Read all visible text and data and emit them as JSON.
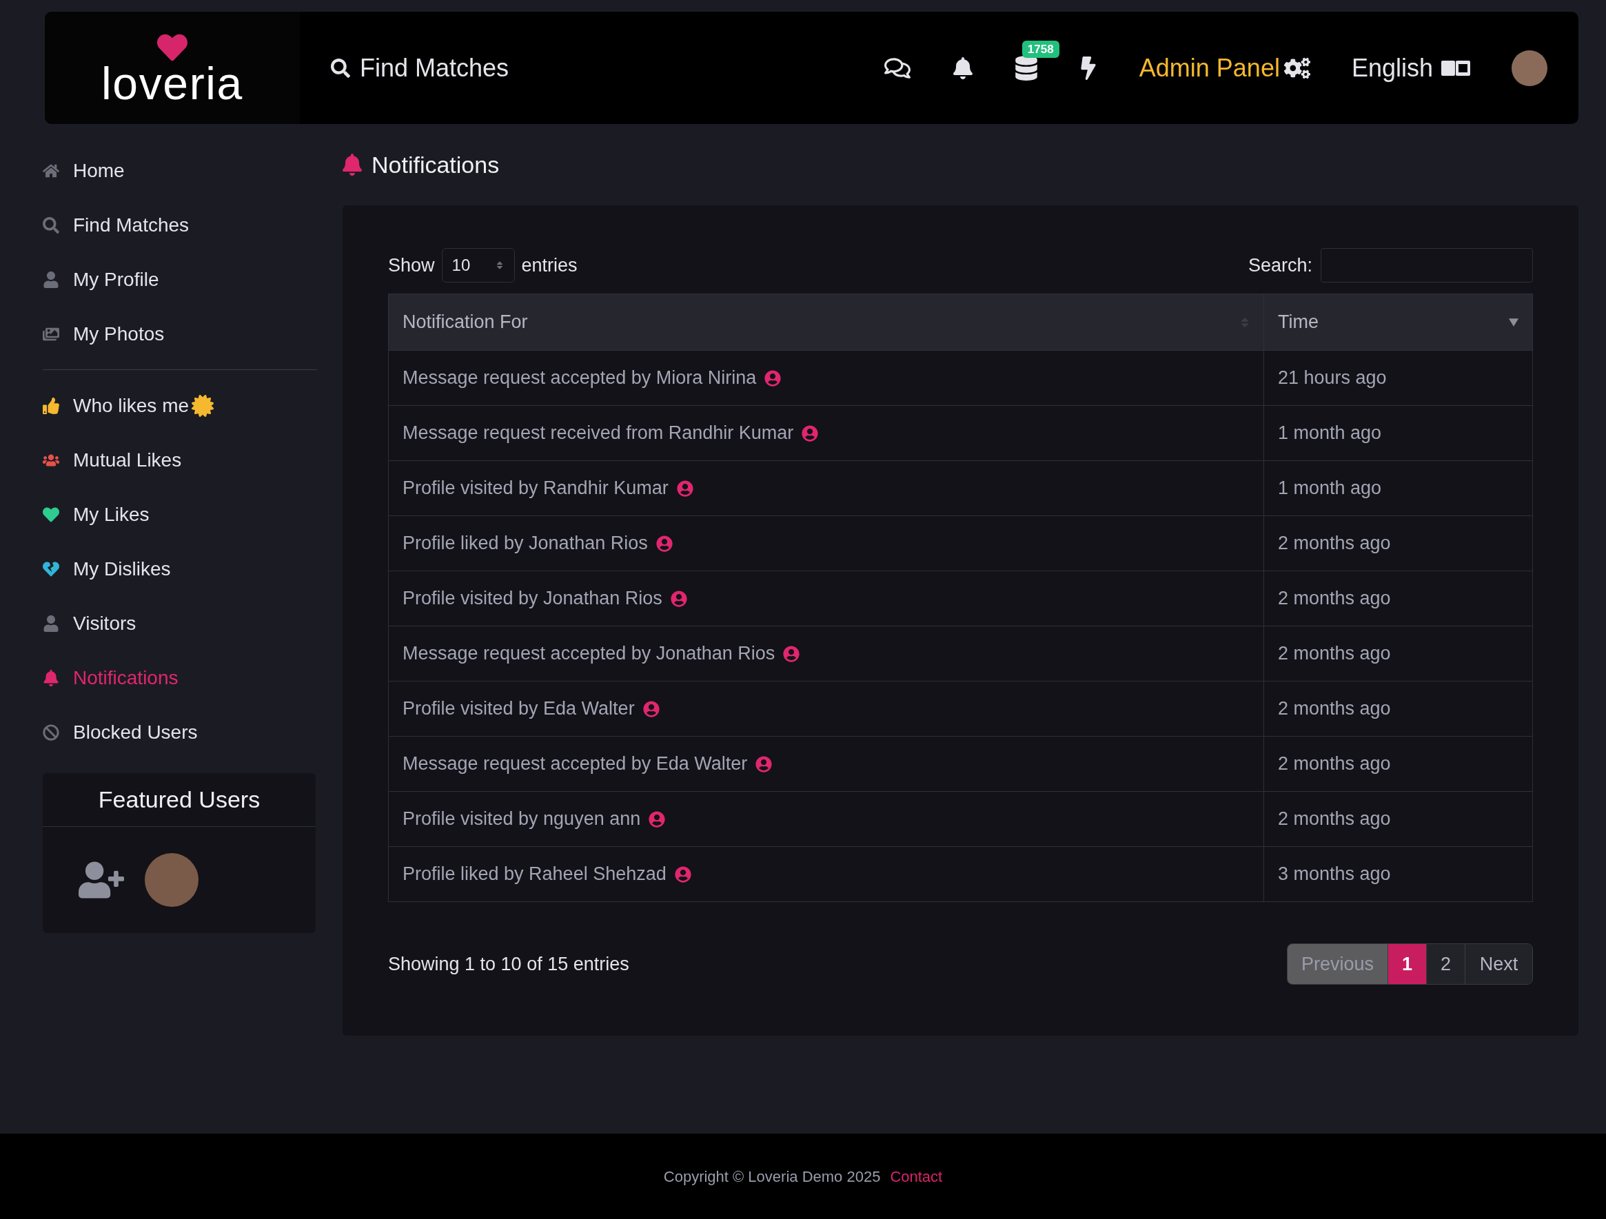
{
  "header": {
    "logo": "loveria",
    "search_link": "Find Matches",
    "credits_badge": "1758",
    "admin_link": "Admin Panel",
    "language": "English"
  },
  "sidebar": {
    "sections": [
      [
        {
          "kind": "home",
          "label": "Home",
          "selected": false,
          "badge": false
        },
        {
          "kind": "search",
          "label": "Find Matches",
          "selected": false,
          "badge": false
        },
        {
          "kind": "user",
          "label": "My Profile",
          "selected": false,
          "badge": false
        },
        {
          "kind": "photos",
          "label": "My Photos",
          "selected": false,
          "badge": false
        }
      ],
      [
        {
          "kind": "thumbs",
          "label": "Who likes me",
          "selected": false,
          "badge": true
        },
        {
          "kind": "users",
          "label": "Mutual Likes",
          "selected": false,
          "badge": false
        },
        {
          "kind": "heart",
          "label": "My Likes",
          "selected": false,
          "badge": false
        },
        {
          "kind": "broken-heart",
          "label": "My Dislikes",
          "selected": false,
          "badge": false
        },
        {
          "kind": "user",
          "label": "Visitors",
          "selected": false,
          "badge": false
        },
        {
          "kind": "bell",
          "label": "Notifications",
          "selected": true,
          "badge": false
        },
        {
          "kind": "ban",
          "label": "Blocked Users",
          "selected": false,
          "badge": false
        }
      ]
    ],
    "featured": {
      "title": "Featured Users"
    }
  },
  "page": {
    "title": "Notifications"
  },
  "table_controls": {
    "show_label": "Show",
    "page_size": "10",
    "entries_label": "entries",
    "search_label": "Search:"
  },
  "table": {
    "columns": [
      {
        "label": "Notification For",
        "sorted": false
      },
      {
        "label": "Time",
        "sorted": true
      }
    ],
    "rows": [
      [
        "Message request accepted by Miora Nirina",
        "21 hours ago"
      ],
      [
        "Message request received from Randhir Kumar",
        "1 month ago"
      ],
      [
        "Profile visited by Randhir Kumar",
        "1 month ago"
      ],
      [
        "Profile liked by Jonathan Rios",
        "2 months ago"
      ],
      [
        "Profile visited by Jonathan Rios",
        "2 months ago"
      ],
      [
        "Message request accepted by Jonathan Rios",
        "2 months ago"
      ],
      [
        "Profile visited by Eda Walter",
        "2 months ago"
      ],
      [
        "Message request accepted by Eda Walter",
        "2 months ago"
      ],
      [
        "Profile visited by nguyen ann",
        "2 months ago"
      ],
      [
        "Profile liked by Raheel Shehzad",
        "3 months ago"
      ]
    ]
  },
  "info": "Showing 1 to 10 of 15 entries",
  "pagination": [
    {
      "label": "Previous",
      "kind": "nav",
      "disabled": true,
      "selected": false
    },
    {
      "label": "1",
      "kind": "page",
      "disabled": false,
      "selected": true
    },
    {
      "label": "2",
      "kind": "page",
      "disabled": false,
      "selected": false
    },
    {
      "label": "Next",
      "kind": "nav",
      "disabled": false,
      "selected": false
    }
  ],
  "footer": {
    "copyright": "Copyright © Loveria Demo 2025",
    "contact": "Contact"
  }
}
